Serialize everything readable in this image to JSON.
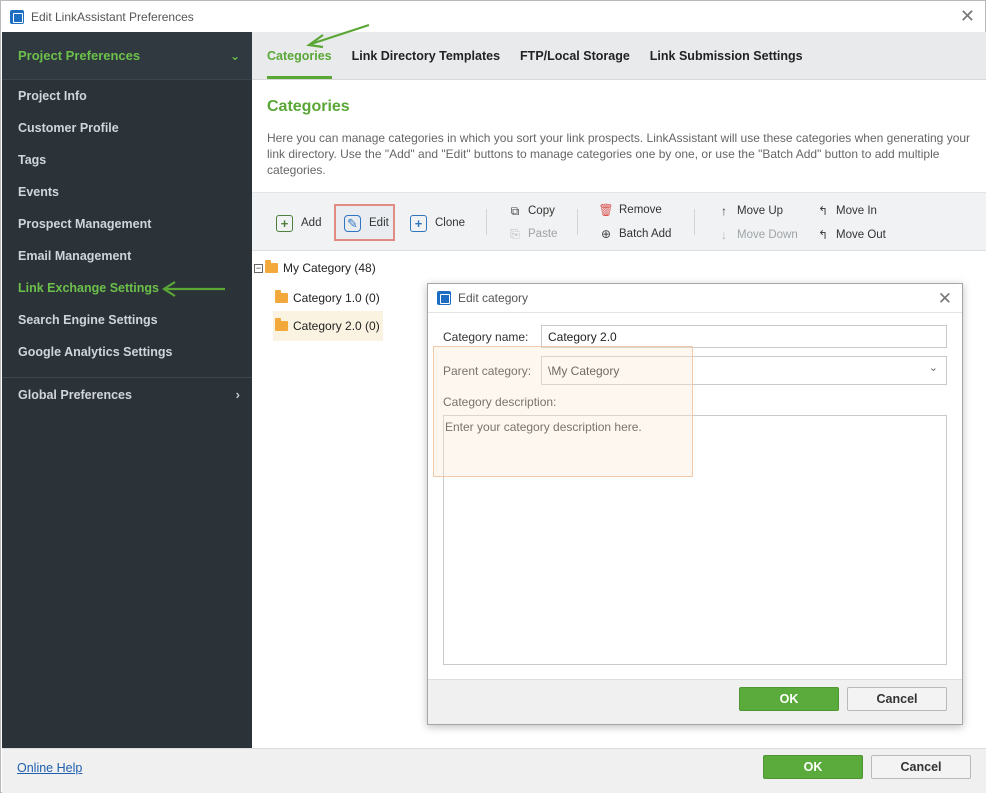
{
  "window": {
    "title": "Edit LinkAssistant Preferences"
  },
  "sidebar": {
    "header": "Project Preferences",
    "items": [
      {
        "label": "Project Info",
        "active": false
      },
      {
        "label": "Customer Profile",
        "active": false
      },
      {
        "label": "Tags",
        "active": false
      },
      {
        "label": "Events",
        "active": false
      },
      {
        "label": "Prospect Management",
        "active": false
      },
      {
        "label": "Email Management",
        "active": false
      },
      {
        "label": "Link Exchange Settings",
        "active": true
      },
      {
        "label": "Search Engine Settings",
        "active": false
      },
      {
        "label": "Google Analytics Settings",
        "active": false
      }
    ],
    "global": "Global Preferences"
  },
  "tabs": [
    {
      "label": "Categories",
      "active": true
    },
    {
      "label": "Link Directory Templates",
      "active": false
    },
    {
      "label": "FTP/Local Storage",
      "active": false
    },
    {
      "label": "Link Submission Settings",
      "active": false
    }
  ],
  "main": {
    "title": "Categories",
    "description": "Here you can manage categories in which you sort your link prospects. LinkAssistant will use these categories when generating your link directory. Use the \"Add\" and \"Edit\" buttons to manage categories one by one, or use the \"Batch Add\" button to add multiple categories."
  },
  "toolbar": {
    "add": "Add",
    "edit": "Edit",
    "clone": "Clone",
    "copy": "Copy",
    "paste": "Paste",
    "remove": "Remove",
    "batch_add": "Batch Add",
    "move_up": "Move Up",
    "move_down": "Move Down",
    "move_in": "Move In",
    "move_out": "Move Out"
  },
  "tree": {
    "root": "My Category (48)",
    "children": [
      "Category 1.0 (0)",
      "Category 2.0 (0)"
    ]
  },
  "dialog": {
    "title": "Edit category",
    "name_label": "Category name:",
    "name_value": "Category 2.0",
    "parent_label": "Parent category:",
    "parent_value": "\\My Category",
    "desc_label": "Category description:",
    "desc_placeholder": "Enter your category description here.",
    "ok": "OK",
    "cancel": "Cancel"
  },
  "footer": {
    "help": "Online Help",
    "ok": "OK",
    "cancel": "Cancel"
  },
  "colors": {
    "accent_green": "#5aa736",
    "sidebar_bg": "#2b3339",
    "ok_button": "#5aab3c",
    "highlight_border": "#e08c83"
  }
}
